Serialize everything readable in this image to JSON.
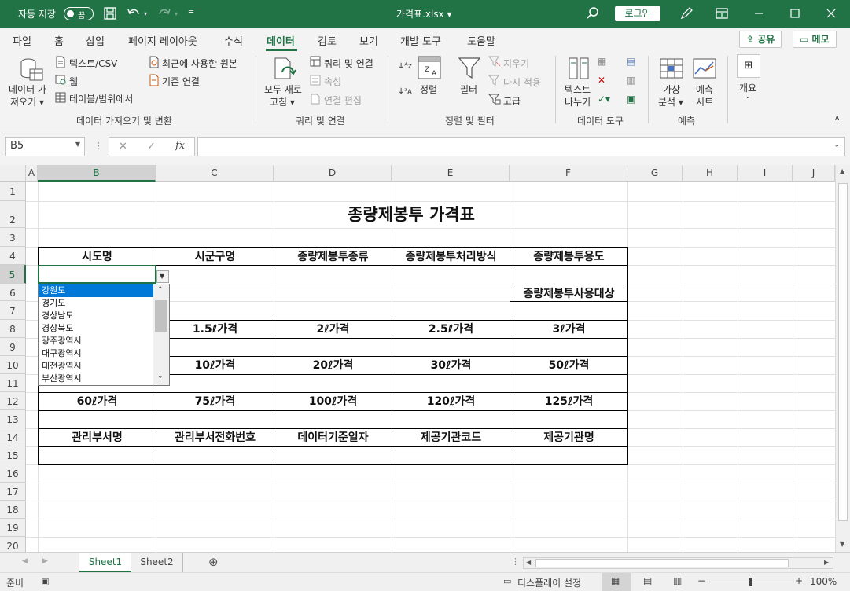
{
  "titlebar": {
    "autosave": "자동 저장",
    "toggle": "끔",
    "filename": "가격표.xlsx",
    "login": "로그인"
  },
  "tabs": [
    "파일",
    "홈",
    "삽입",
    "페이지 레이아웃",
    "수식",
    "데이터",
    "검토",
    "보기",
    "개발 도구",
    "도움말"
  ],
  "active_tab": "데이터",
  "share": "공유",
  "memo": "메모",
  "ribbon": {
    "get_data": "데이터 가",
    "get_data2": "져오기",
    "text_csv": "텍스트/CSV",
    "web": "웹",
    "table_range": "테이블/범위에서",
    "recent_sources": "최근에 사용한 원본",
    "existing_conn": "기존 연결",
    "group1": "데이터 가져오기 및 변환",
    "refresh_all": "모두 새로",
    "refresh_all2": "고침",
    "queries_conn": "쿼리 및 연결",
    "properties": "속성",
    "edit_links": "연결 편집",
    "group2": "쿼리 및 연결",
    "sort": "정렬",
    "filter": "필터",
    "clear": "지우기",
    "reapply": "다시 적용",
    "advanced": "고급",
    "group3": "정렬 및 필터",
    "text_to_col": "텍스트",
    "text_to_col2": "나누기",
    "group4": "데이터 도구",
    "whatif": "가상",
    "whatif2": "분석",
    "forecast": "예측",
    "forecast2": "시트",
    "group5": "예측",
    "outline": "개요"
  },
  "formula_bar": {
    "namebox": "B5",
    "fx": "fx"
  },
  "columns": [
    "A",
    "B",
    "C",
    "D",
    "E",
    "F",
    "G",
    "H",
    "I",
    "J"
  ],
  "rows": [
    "1",
    "2",
    "3",
    "4",
    "5",
    "6",
    "7",
    "8",
    "9",
    "10",
    "11",
    "12",
    "13",
    "14",
    "15",
    "16",
    "17",
    "18",
    "19",
    "20"
  ],
  "sheet": {
    "title": "종량제봉투 가격표",
    "r4": [
      "시도명",
      "시군구명",
      "종량제봉투종류",
      "종량제봉투처리방식",
      "종량제봉투용도"
    ],
    "r6f": "종량제봉투사용대상",
    "r8": [
      "1.5ℓ가격",
      "2ℓ가격",
      "2.5ℓ가격",
      "3ℓ가격"
    ],
    "r10": [
      "10ℓ가격",
      "20ℓ가격",
      "30ℓ가격",
      "50ℓ가격"
    ],
    "r12": [
      "60ℓ가격",
      "75ℓ가격",
      "100ℓ가격",
      "120ℓ가격",
      "125ℓ가격"
    ],
    "r14": [
      "관리부서명",
      "관리부서전화번호",
      "데이터기준일자",
      "제공기관코드",
      "제공기관명"
    ]
  },
  "dropdown": {
    "items": [
      "강원도",
      "경기도",
      "경상남도",
      "경상북도",
      "광주광역시",
      "대구광역시",
      "대전광역시",
      "부산광역시"
    ],
    "selected": "강원도"
  },
  "sheet_tabs": [
    "Sheet1",
    "Sheet2"
  ],
  "status": {
    "ready": "준비",
    "display_settings": "디스플레이 설정",
    "zoom": "100%"
  }
}
